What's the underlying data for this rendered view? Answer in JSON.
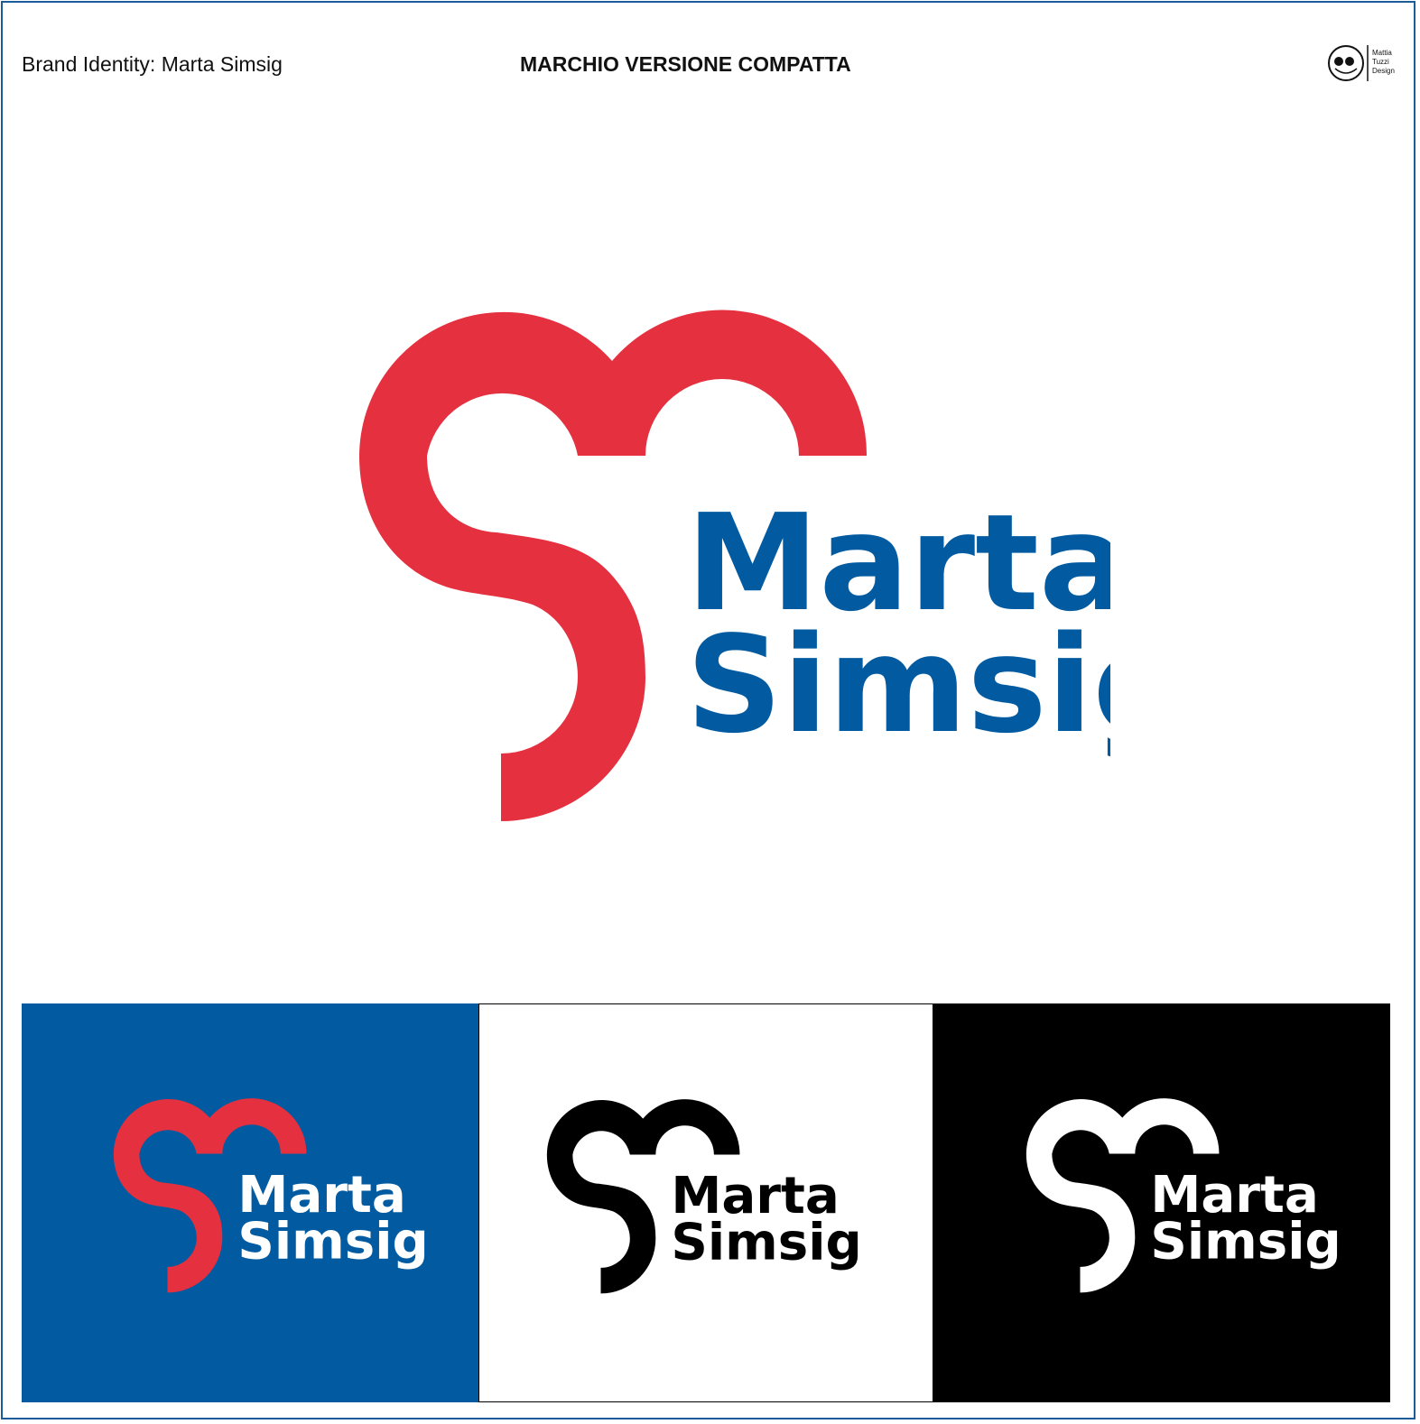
{
  "header": {
    "left_title": "Brand Identity: Marta Simsig",
    "center_title": "MARCHIO VERSIONE COMPATTA",
    "studio_line1": "Mattia",
    "studio_line2": "Tuzzi",
    "studio_line3": "Design"
  },
  "logo": {
    "line1": "Marta",
    "line2": "Simsig"
  },
  "colors": {
    "red": "#e5303f",
    "blue": "#025ba1",
    "black": "#000000",
    "white": "#ffffff",
    "frame": "#1a5c9a"
  },
  "variants": [
    {
      "name": "blue-background",
      "background": "#025ba1",
      "mark": "#e5303f",
      "text": "#ffffff"
    },
    {
      "name": "white-background",
      "background": "#ffffff",
      "mark": "#000000",
      "text": "#000000"
    },
    {
      "name": "black-background",
      "background": "#000000",
      "mark": "#ffffff",
      "text": "#ffffff"
    }
  ]
}
